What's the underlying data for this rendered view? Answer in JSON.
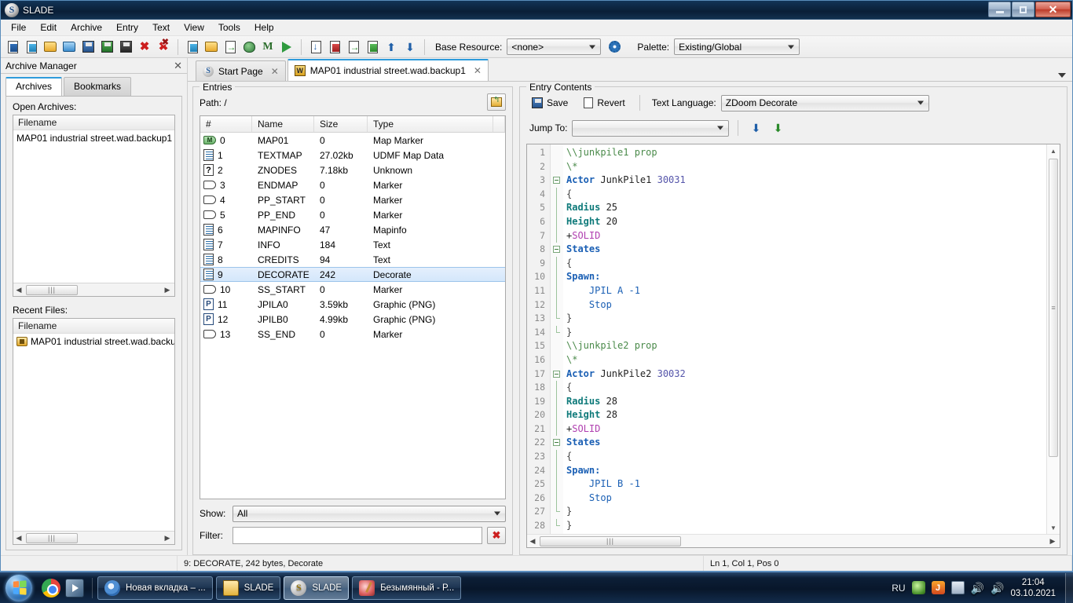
{
  "window": {
    "title": "SLADE",
    "app_icon": "slade-icon",
    "controls": {
      "minimize": "minimize",
      "maximize": "maximize",
      "close": "close"
    }
  },
  "menubar": {
    "items": [
      "File",
      "Edit",
      "Archive",
      "Entry",
      "Text",
      "View",
      "Tools",
      "Help"
    ]
  },
  "toolbar": {
    "buttons": [
      {
        "name": "new-archive",
        "icon": "new-archive-icon"
      },
      {
        "name": "new-entry",
        "icon": "new-entry-icon"
      },
      {
        "name": "open-archive",
        "icon": "open-folder-icon"
      },
      {
        "name": "open-directory",
        "icon": "open-folder-blue-icon"
      },
      {
        "name": "save-archive",
        "icon": "save-disk-blue-icon"
      },
      {
        "name": "save-archive-as",
        "icon": "save-disk-green-icon"
      },
      {
        "name": "save-all",
        "icon": "save-disk-dark-icon"
      },
      {
        "name": "close-archive",
        "icon": "close-x-icon"
      },
      {
        "name": "close-all-archives",
        "icon": "close-all-x-icon"
      },
      {
        "name": "new-text-entry",
        "icon": "text-entry-icon"
      },
      {
        "name": "new-directory",
        "icon": "folder-icon"
      },
      {
        "name": "import-entry",
        "icon": "import-icon"
      },
      {
        "name": "maps-editor",
        "icon": "map-editor-icon"
      },
      {
        "name": "map-marker",
        "icon": "map-m-icon"
      },
      {
        "name": "run-archive",
        "icon": "play-icon"
      }
    ],
    "entry_buttons": [
      {
        "name": "entry-properties",
        "icon": "entry-properties-icon"
      },
      {
        "name": "delete-entry",
        "icon": "delete-entry-icon"
      },
      {
        "name": "import-entry-2",
        "icon": "import-entry-icon"
      },
      {
        "name": "export-entry",
        "icon": "export-entry-icon"
      },
      {
        "name": "move-up",
        "icon": "arrow-up-icon"
      },
      {
        "name": "move-down",
        "icon": "arrow-down-icon"
      }
    ],
    "base_resource_label": "Base Resource:",
    "base_resource_value": "<none>",
    "base_resource_settings_icon": "gear-icon",
    "palette_label": "Palette:",
    "palette_value": "Existing/Global"
  },
  "archive_manager": {
    "title": "Archive Manager",
    "close_icon": "close-icon",
    "tabs": [
      {
        "label": "Archives",
        "active": true
      },
      {
        "label": "Bookmarks",
        "active": false
      }
    ],
    "open_archives_label": "Open Archives:",
    "open_archives_header": "Filename",
    "open_archives": [
      {
        "filename": "MAP01 industrial street.wad.backup1"
      }
    ],
    "recent_files_label": "Recent Files:",
    "recent_files_header": "Filename",
    "recent_files": [
      {
        "filename": "MAP01 industrial street.wad.backu",
        "icon": "archive-file-icon"
      }
    ]
  },
  "doc_tabs": {
    "tabs": [
      {
        "label": "Start Page",
        "icon": "slade-icon",
        "active": false,
        "close_icon": "close-icon"
      },
      {
        "label": "MAP01 industrial street.wad.backup1",
        "icon": "wad-icon",
        "active": true,
        "close_icon": "close-icon"
      }
    ],
    "overflow_icon": "chevron-down-icon"
  },
  "entries": {
    "group_title": "Entries",
    "path_label": "Path: /",
    "up_button_icon": "folder-up-icon",
    "columns": [
      "#",
      "Name",
      "Size",
      "Type"
    ],
    "rows": [
      {
        "num": "0",
        "name": "MAP01",
        "size": "0",
        "type": "Map Marker",
        "icon": "map-marker-icon",
        "selected": false
      },
      {
        "num": "1",
        "name": "TEXTMAP",
        "size": "27.02kb",
        "type": "UDMF Map Data",
        "icon": "text-icon",
        "selected": false
      },
      {
        "num": "2",
        "name": "ZNODES",
        "size": "7.18kb",
        "type": "Unknown",
        "icon": "unknown-icon",
        "selected": false
      },
      {
        "num": "3",
        "name": "ENDMAP",
        "size": "0",
        "type": "Marker",
        "icon": "marker-icon",
        "selected": false
      },
      {
        "num": "4",
        "name": "PP_START",
        "size": "0",
        "type": "Marker",
        "icon": "marker-icon",
        "selected": false
      },
      {
        "num": "5",
        "name": "PP_END",
        "size": "0",
        "type": "Marker",
        "icon": "marker-icon",
        "selected": false
      },
      {
        "num": "6",
        "name": "MAPINFO",
        "size": "47",
        "type": "Mapinfo",
        "icon": "text-icon",
        "selected": false
      },
      {
        "num": "7",
        "name": "INFO",
        "size": "184",
        "type": "Text",
        "icon": "text-icon",
        "selected": false
      },
      {
        "num": "8",
        "name": "CREDITS",
        "size": "94",
        "type": "Text",
        "icon": "text-icon",
        "selected": false
      },
      {
        "num": "9",
        "name": "DECORATE",
        "size": "242",
        "type": "Decorate",
        "icon": "text-icon",
        "selected": true
      },
      {
        "num": "10",
        "name": "SS_START",
        "size": "0",
        "type": "Marker",
        "icon": "marker-icon",
        "selected": false
      },
      {
        "num": "11",
        "name": "JPILA0",
        "size": "3.59kb",
        "type": "Graphic (PNG)",
        "icon": "png-icon",
        "selected": false
      },
      {
        "num": "12",
        "name": "JPILB0",
        "size": "4.99kb",
        "type": "Graphic (PNG)",
        "icon": "png-icon",
        "selected": false
      },
      {
        "num": "13",
        "name": "SS_END",
        "size": "0",
        "type": "Marker",
        "icon": "marker-icon",
        "selected": false
      }
    ],
    "show_label": "Show:",
    "show_value": "All",
    "filter_label": "Filter:",
    "filter_value": "",
    "clear_filter_icon": "red-x-icon"
  },
  "entry_contents": {
    "group_title": "Entry Contents",
    "save_label": "Save",
    "save_icon": "save-disk-icon",
    "revert_label": "Revert",
    "revert_icon": "revert-icon",
    "text_language_label": "Text Language:",
    "text_language_value": "ZDoom Decorate",
    "jump_to_label": "Jump To:",
    "jump_to_value": "",
    "jump_button_1_icon": "jump-down-blue-icon",
    "jump_button_2_icon": "jump-down-green-icon",
    "code_lines": [
      {
        "n": "1",
        "fold": "none",
        "tokens": [
          {
            "t": "\\\\junkpile1 prop",
            "c": "k-comment"
          }
        ]
      },
      {
        "n": "2",
        "fold": "none",
        "tokens": [
          {
            "t": "\\*",
            "c": "k-comment"
          }
        ]
      },
      {
        "n": "3",
        "fold": "start",
        "tokens": [
          {
            "t": "Actor",
            "c": "k-kw"
          },
          {
            "t": " JunkPile1 ",
            "c": "k-plain"
          },
          {
            "t": "30031",
            "c": "k-num"
          }
        ]
      },
      {
        "n": "4",
        "fold": "line",
        "tokens": [
          {
            "t": "{",
            "c": "k-brace"
          }
        ]
      },
      {
        "n": "5",
        "fold": "line",
        "tokens": [
          {
            "t": "Radius",
            "c": "k-type"
          },
          {
            "t": " 25",
            "c": "k-plain"
          }
        ]
      },
      {
        "n": "6",
        "fold": "line",
        "tokens": [
          {
            "t": "Height",
            "c": "k-type"
          },
          {
            "t": " 20",
            "c": "k-plain"
          }
        ]
      },
      {
        "n": "7",
        "fold": "line",
        "tokens": [
          {
            "t": "+",
            "c": "k-plain"
          },
          {
            "t": "SOLID",
            "c": "k-flag"
          }
        ]
      },
      {
        "n": "8",
        "fold": "start",
        "tokens": [
          {
            "t": "States",
            "c": "k-kw"
          }
        ]
      },
      {
        "n": "9",
        "fold": "line",
        "tokens": [
          {
            "t": "{",
            "c": "k-brace"
          }
        ]
      },
      {
        "n": "10",
        "fold": "line",
        "tokens": [
          {
            "t": "Spawn:",
            "c": "k-label"
          }
        ]
      },
      {
        "n": "11",
        "fold": "line",
        "tokens": [
          {
            "t": "    JPIL A -1",
            "c": "k-state"
          }
        ]
      },
      {
        "n": "12",
        "fold": "line",
        "tokens": [
          {
            "t": "    Stop",
            "c": "k-state"
          }
        ]
      },
      {
        "n": "13",
        "fold": "end",
        "tokens": [
          {
            "t": "}",
            "c": "k-brace"
          }
        ]
      },
      {
        "n": "14",
        "fold": "end",
        "tokens": [
          {
            "t": "}",
            "c": "k-brace"
          }
        ]
      },
      {
        "n": "15",
        "fold": "none",
        "tokens": [
          {
            "t": "\\\\junkpile2 prop",
            "c": "k-comment"
          }
        ]
      },
      {
        "n": "16",
        "fold": "none",
        "tokens": [
          {
            "t": "\\*",
            "c": "k-comment"
          }
        ]
      },
      {
        "n": "17",
        "fold": "start",
        "tokens": [
          {
            "t": "Actor",
            "c": "k-kw"
          },
          {
            "t": " JunkPile2 ",
            "c": "k-plain"
          },
          {
            "t": "30032",
            "c": "k-num"
          }
        ]
      },
      {
        "n": "18",
        "fold": "line",
        "tokens": [
          {
            "t": "{",
            "c": "k-brace"
          }
        ]
      },
      {
        "n": "19",
        "fold": "line",
        "tokens": [
          {
            "t": "Radius",
            "c": "k-type"
          },
          {
            "t": " 28",
            "c": "k-plain"
          }
        ]
      },
      {
        "n": "20",
        "fold": "line",
        "tokens": [
          {
            "t": "Height",
            "c": "k-type"
          },
          {
            "t": " 28",
            "c": "k-plain"
          }
        ]
      },
      {
        "n": "21",
        "fold": "line",
        "tokens": [
          {
            "t": "+",
            "c": "k-plain"
          },
          {
            "t": "SOLID",
            "c": "k-flag"
          }
        ]
      },
      {
        "n": "22",
        "fold": "start",
        "tokens": [
          {
            "t": "States",
            "c": "k-kw"
          }
        ]
      },
      {
        "n": "23",
        "fold": "line",
        "tokens": [
          {
            "t": "{",
            "c": "k-brace"
          }
        ]
      },
      {
        "n": "24",
        "fold": "line",
        "tokens": [
          {
            "t": "Spawn:",
            "c": "k-label"
          }
        ]
      },
      {
        "n": "25",
        "fold": "line",
        "tokens": [
          {
            "t": "    JPIL B -1",
            "c": "k-state"
          }
        ]
      },
      {
        "n": "26",
        "fold": "line",
        "tokens": [
          {
            "t": "    Stop",
            "c": "k-state"
          }
        ]
      },
      {
        "n": "27",
        "fold": "end",
        "tokens": [
          {
            "t": "}",
            "c": "k-brace"
          }
        ]
      },
      {
        "n": "28",
        "fold": "end",
        "tokens": [
          {
            "t": "}",
            "c": "k-brace"
          }
        ]
      }
    ]
  },
  "statusbar": {
    "left": "",
    "middle": "9: DECORATE, 242 bytes, Decorate",
    "right": "Ln 1, Col 1, Pos 0"
  },
  "taskbar": {
    "start_icon": "windows-start-icon",
    "quick_launch": [
      {
        "name": "chrome",
        "icon": "chrome-icon"
      },
      {
        "name": "media-player",
        "icon": "media-player-icon"
      }
    ],
    "tasks": [
      {
        "label": "Новая вкладка – ...",
        "icon": "chrome-icon",
        "active": false
      },
      {
        "label": "SLADE",
        "icon": "folder-icon",
        "active": false
      },
      {
        "label": "SLADE",
        "icon": "slade-icon",
        "active": true
      },
      {
        "label": "Безымянный - Р...",
        "icon": "paint-icon",
        "active": false
      }
    ],
    "tray": {
      "language": "RU",
      "icons": [
        "nvidia-icon",
        "java-icon",
        "network-icon",
        "volume-icon",
        "volume-red-icon"
      ],
      "time": "21:04",
      "date": "03.10.2021"
    }
  }
}
